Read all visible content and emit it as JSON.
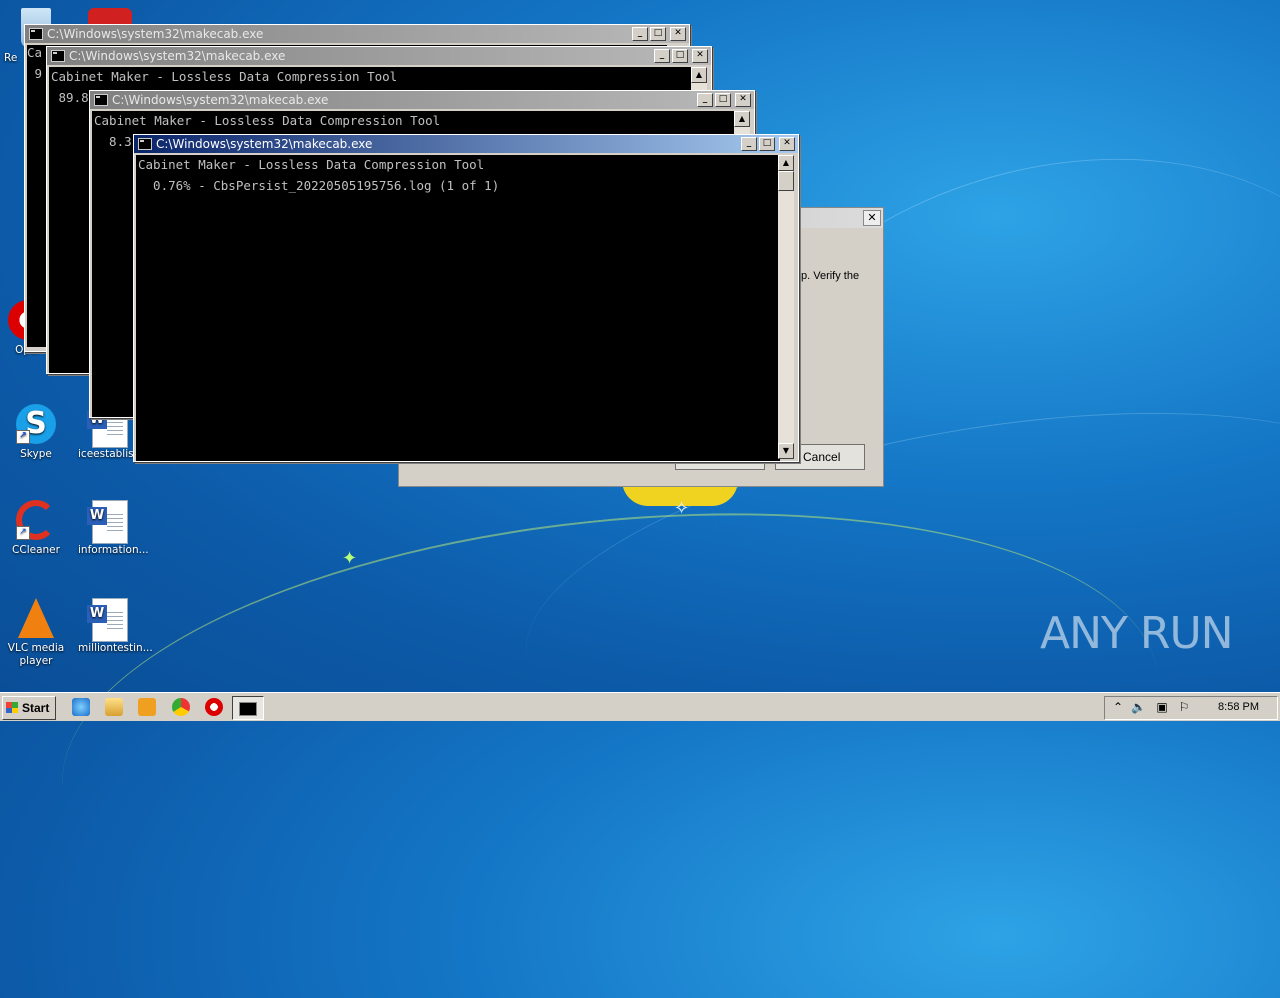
{
  "desktop": {
    "icons": [
      {
        "label": "Re",
        "type": "recycle"
      },
      {
        "label": "Oper",
        "type": "opera"
      },
      {
        "label": "Skype",
        "type": "skype"
      },
      {
        "label": "iceestablish...",
        "type": "word"
      },
      {
        "label": "CCleaner",
        "type": "ccleaner"
      },
      {
        "label": "information...",
        "type": "word"
      },
      {
        "label": "VLC media player",
        "type": "vlc"
      },
      {
        "label": "milliontestin...",
        "type": "word"
      }
    ]
  },
  "windows": [
    {
      "title": "C:\\Windows\\system32\\makecab.exe",
      "line1": "Ca",
      "line2": " 9"
    },
    {
      "title": "C:\\Windows\\system32\\makecab.exe",
      "line1": "Cabinet Maker - Lossless Data Compression Tool",
      "line2": " 89.8"
    },
    {
      "title": "C:\\Windows\\system32\\makecab.exe",
      "line1": "Cabinet Maker - Lossless Data Compression Tool",
      "line2": "  8.3"
    },
    {
      "title": "C:\\Windows\\system32\\makecab.exe",
      "line1": "Cabinet Maker - Lossless Data Compression Tool",
      "line2": "  0.76% - CbsPersist_20220505195756.log (1 of 1)"
    }
  ],
  "dialog": {
    "message": "p. Verify the",
    "cancel_label": "Cancel"
  },
  "taskbar": {
    "start_label": "Start",
    "clock": "8:58 PM"
  },
  "watermark": "ANY RUN",
  "colors": {
    "desktop": "#1476c6",
    "active_title": "#0a246a",
    "console_bg": "#000000",
    "console_text": "#c0c0c0"
  }
}
